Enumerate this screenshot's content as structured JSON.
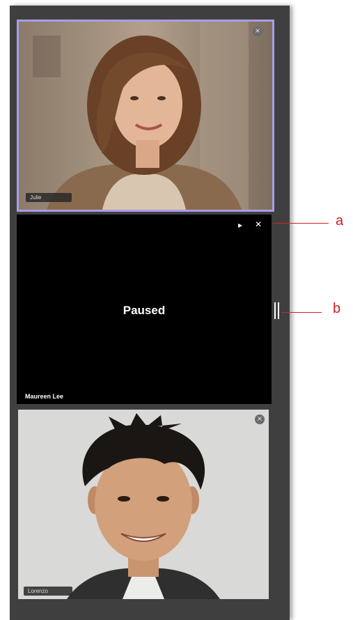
{
  "tiles": [
    {
      "participant_name": "Julie",
      "state": "video",
      "highlighted": true
    },
    {
      "participant_name": "Maureen Lee",
      "state": "paused",
      "status_text": "Paused"
    },
    {
      "participant_name": "Lorenzo",
      "state": "video"
    }
  ],
  "icons": {
    "close": "×",
    "play": "▸",
    "close_small": "✕"
  },
  "callouts": {
    "a": "a",
    "b": "b"
  },
  "colors": {
    "panel_bg": "#3f3f3f",
    "active_border": "#a99ce6",
    "callout_red": "#cc1f1f"
  }
}
